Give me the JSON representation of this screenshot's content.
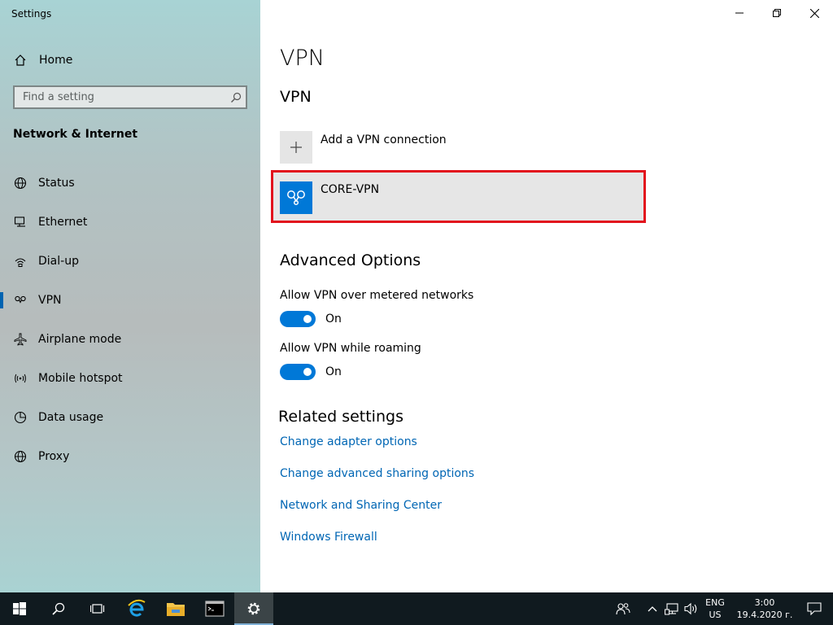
{
  "window": {
    "title": "Settings"
  },
  "sidebar": {
    "home_label": "Home",
    "search_placeholder": "Find a setting",
    "section_title": "Network & Internet",
    "items": [
      {
        "label": "Status",
        "icon": "globe-icon"
      },
      {
        "label": "Ethernet",
        "icon": "ethernet-icon"
      },
      {
        "label": "Dial-up",
        "icon": "dialup-icon"
      },
      {
        "label": "VPN",
        "icon": "vpn-icon",
        "active": true
      },
      {
        "label": "Airplane mode",
        "icon": "airplane-icon"
      },
      {
        "label": "Mobile hotspot",
        "icon": "hotspot-icon"
      },
      {
        "label": "Data usage",
        "icon": "data-usage-icon"
      },
      {
        "label": "Proxy",
        "icon": "globe-icon"
      }
    ]
  },
  "main": {
    "page_title": "VPN",
    "vpn_heading": "VPN",
    "add_vpn_label": "Add a VPN connection",
    "vpn_connections": [
      {
        "name": "CORE-VPN"
      }
    ],
    "advanced_heading": "Advanced Options",
    "options": [
      {
        "label": "Allow VPN over metered networks",
        "state": "On"
      },
      {
        "label": "Allow VPN while roaming",
        "state": "On"
      }
    ],
    "related_heading": "Related settings",
    "related_links": [
      "Change adapter options",
      "Change advanced sharing options",
      "Network and Sharing Center",
      "Windows Firewall"
    ]
  },
  "taskbar": {
    "apps": [
      "start-icon",
      "search-icon",
      "task-view-icon",
      "internet-explorer-icon",
      "file-explorer-icon",
      "command-prompt-icon",
      "settings-icon"
    ],
    "language_line1": "ENG",
    "language_line2": "US",
    "time": "3:00",
    "date": "19.4.2020 г."
  },
  "colors": {
    "accent": "#0078d7",
    "link": "#0066b4",
    "highlight_border": "#e2131d",
    "taskbar": "#101a1f"
  }
}
